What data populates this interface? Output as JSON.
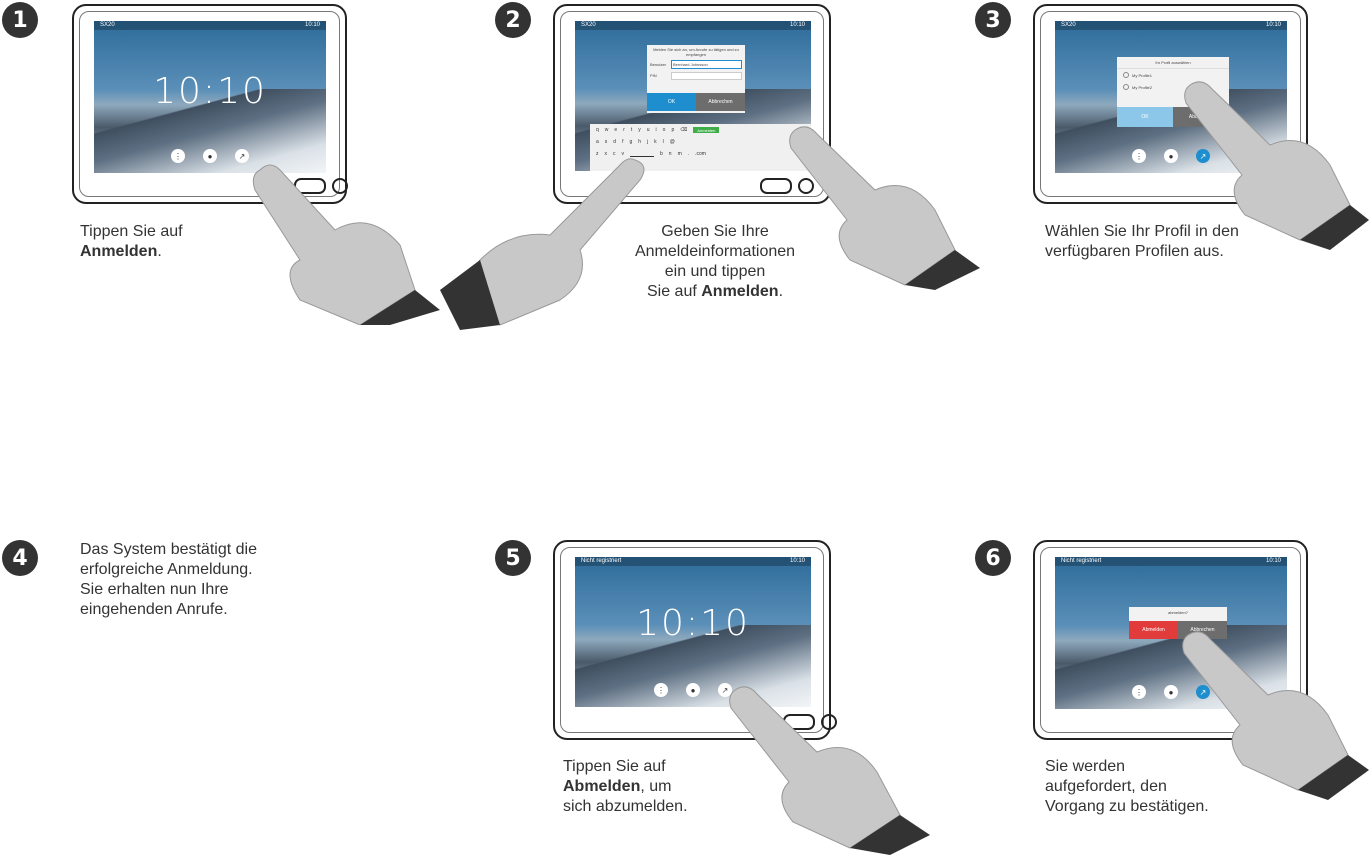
{
  "steps": [
    {
      "num": "1",
      "text_pre": "Tippen Sie auf",
      "bold": "Anmelden",
      "text_post": "."
    },
    {
      "num": "2",
      "line1": "Geben Sie Ihre",
      "line2": "Anmeldeinformationen",
      "line3": "ein und tippen",
      "line4_pre": "Sie auf ",
      "bold": "Anmelden",
      "line4_post": "."
    },
    {
      "num": "3",
      "line1": "Wählen Sie Ihr Profil in den",
      "line2": "verfügbaren Profilen aus."
    },
    {
      "num": "4",
      "line1": "Das System bestätigt die",
      "line2": "erfolgreiche Anmeldung.",
      "line3": "Sie erhalten nun Ihre",
      "line4": "eingehenden Anrufe."
    },
    {
      "num": "5",
      "text_pre": "Tippen Sie auf",
      "bold": "Abmelden",
      "text_post": ", um",
      "line3": "sich abzumelden."
    },
    {
      "num": "6",
      "line1": "Sie werden",
      "line2": "aufgefordert, den",
      "line3": "Vorgang zu bestätigen."
    }
  ],
  "screens": {
    "clock": "10:10",
    "status_left_1": "SX20",
    "status_left_5": "Nicht registriert",
    "status_time": "10:10",
    "login_dialog": {
      "header": "Melden Sie sich an, um Anrufe zu tätigen und zu empfangen",
      "user_label": "Benutzer",
      "user_value": "Bernhard Johnsson",
      "pin_label": "PIN",
      "ok": "OK",
      "cancel": "Abbrechen"
    },
    "keyboard": {
      "row1": [
        "q",
        "w",
        "e",
        "r",
        "t",
        "y",
        "u",
        "i",
        "o",
        "p"
      ],
      "row2": [
        "a",
        "s",
        "d",
        "f",
        "g",
        "h",
        "j",
        "k",
        "l",
        "@"
      ],
      "row3": [
        "z",
        "x",
        "c",
        "v",
        "b",
        "n",
        "m",
        ".",
        ".com"
      ],
      "submit": "Anmelden"
    },
    "profile_dialog": {
      "header": "Ihr Profil auswählen",
      "options": [
        "My Profile1",
        "My Profile2"
      ],
      "ok": "OK",
      "cancel": "Abbrechen"
    },
    "logout_dialog": {
      "header": "abmelden?",
      "confirm": "Abmelden",
      "cancel": "Abbrechen"
    },
    "dock_labels": [
      "Wählfeld",
      "Kontakte",
      "Anmelden"
    ]
  }
}
